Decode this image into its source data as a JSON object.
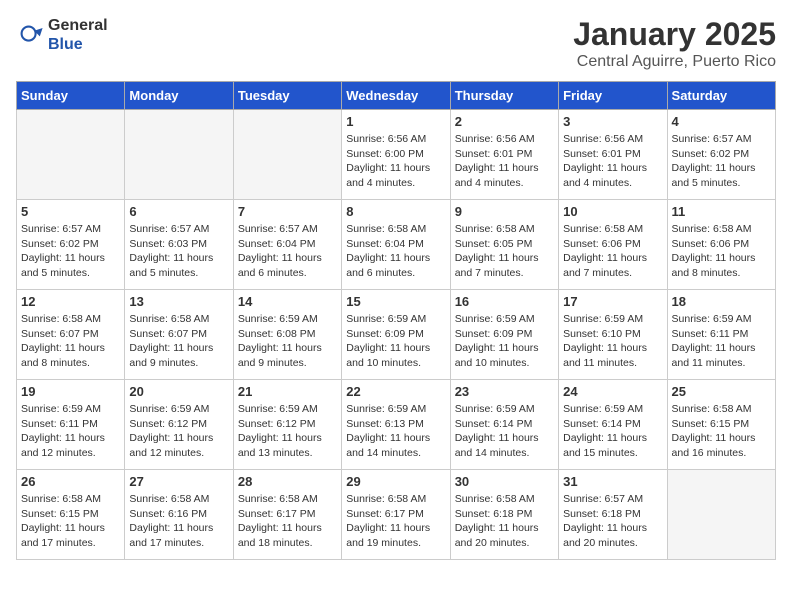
{
  "logo": {
    "general": "General",
    "blue": "Blue"
  },
  "header": {
    "month": "January 2025",
    "location": "Central Aguirre, Puerto Rico"
  },
  "days_of_week": [
    "Sunday",
    "Monday",
    "Tuesday",
    "Wednesday",
    "Thursday",
    "Friday",
    "Saturday"
  ],
  "weeks": [
    [
      {
        "day": "",
        "info": ""
      },
      {
        "day": "",
        "info": ""
      },
      {
        "day": "",
        "info": ""
      },
      {
        "day": "1",
        "info": "Sunrise: 6:56 AM\nSunset: 6:00 PM\nDaylight: 11 hours and 4 minutes."
      },
      {
        "day": "2",
        "info": "Sunrise: 6:56 AM\nSunset: 6:01 PM\nDaylight: 11 hours and 4 minutes."
      },
      {
        "day": "3",
        "info": "Sunrise: 6:56 AM\nSunset: 6:01 PM\nDaylight: 11 hours and 4 minutes."
      },
      {
        "day": "4",
        "info": "Sunrise: 6:57 AM\nSunset: 6:02 PM\nDaylight: 11 hours and 5 minutes."
      }
    ],
    [
      {
        "day": "5",
        "info": "Sunrise: 6:57 AM\nSunset: 6:02 PM\nDaylight: 11 hours and 5 minutes."
      },
      {
        "day": "6",
        "info": "Sunrise: 6:57 AM\nSunset: 6:03 PM\nDaylight: 11 hours and 5 minutes."
      },
      {
        "day": "7",
        "info": "Sunrise: 6:57 AM\nSunset: 6:04 PM\nDaylight: 11 hours and 6 minutes."
      },
      {
        "day": "8",
        "info": "Sunrise: 6:58 AM\nSunset: 6:04 PM\nDaylight: 11 hours and 6 minutes."
      },
      {
        "day": "9",
        "info": "Sunrise: 6:58 AM\nSunset: 6:05 PM\nDaylight: 11 hours and 7 minutes."
      },
      {
        "day": "10",
        "info": "Sunrise: 6:58 AM\nSunset: 6:06 PM\nDaylight: 11 hours and 7 minutes."
      },
      {
        "day": "11",
        "info": "Sunrise: 6:58 AM\nSunset: 6:06 PM\nDaylight: 11 hours and 8 minutes."
      }
    ],
    [
      {
        "day": "12",
        "info": "Sunrise: 6:58 AM\nSunset: 6:07 PM\nDaylight: 11 hours and 8 minutes."
      },
      {
        "day": "13",
        "info": "Sunrise: 6:58 AM\nSunset: 6:07 PM\nDaylight: 11 hours and 9 minutes."
      },
      {
        "day": "14",
        "info": "Sunrise: 6:59 AM\nSunset: 6:08 PM\nDaylight: 11 hours and 9 minutes."
      },
      {
        "day": "15",
        "info": "Sunrise: 6:59 AM\nSunset: 6:09 PM\nDaylight: 11 hours and 10 minutes."
      },
      {
        "day": "16",
        "info": "Sunrise: 6:59 AM\nSunset: 6:09 PM\nDaylight: 11 hours and 10 minutes."
      },
      {
        "day": "17",
        "info": "Sunrise: 6:59 AM\nSunset: 6:10 PM\nDaylight: 11 hours and 11 minutes."
      },
      {
        "day": "18",
        "info": "Sunrise: 6:59 AM\nSunset: 6:11 PM\nDaylight: 11 hours and 11 minutes."
      }
    ],
    [
      {
        "day": "19",
        "info": "Sunrise: 6:59 AM\nSunset: 6:11 PM\nDaylight: 11 hours and 12 minutes."
      },
      {
        "day": "20",
        "info": "Sunrise: 6:59 AM\nSunset: 6:12 PM\nDaylight: 11 hours and 12 minutes."
      },
      {
        "day": "21",
        "info": "Sunrise: 6:59 AM\nSunset: 6:12 PM\nDaylight: 11 hours and 13 minutes."
      },
      {
        "day": "22",
        "info": "Sunrise: 6:59 AM\nSunset: 6:13 PM\nDaylight: 11 hours and 14 minutes."
      },
      {
        "day": "23",
        "info": "Sunrise: 6:59 AM\nSunset: 6:14 PM\nDaylight: 11 hours and 14 minutes."
      },
      {
        "day": "24",
        "info": "Sunrise: 6:59 AM\nSunset: 6:14 PM\nDaylight: 11 hours and 15 minutes."
      },
      {
        "day": "25",
        "info": "Sunrise: 6:58 AM\nSunset: 6:15 PM\nDaylight: 11 hours and 16 minutes."
      }
    ],
    [
      {
        "day": "26",
        "info": "Sunrise: 6:58 AM\nSunset: 6:15 PM\nDaylight: 11 hours and 17 minutes."
      },
      {
        "day": "27",
        "info": "Sunrise: 6:58 AM\nSunset: 6:16 PM\nDaylight: 11 hours and 17 minutes."
      },
      {
        "day": "28",
        "info": "Sunrise: 6:58 AM\nSunset: 6:17 PM\nDaylight: 11 hours and 18 minutes."
      },
      {
        "day": "29",
        "info": "Sunrise: 6:58 AM\nSunset: 6:17 PM\nDaylight: 11 hours and 19 minutes."
      },
      {
        "day": "30",
        "info": "Sunrise: 6:58 AM\nSunset: 6:18 PM\nDaylight: 11 hours and 20 minutes."
      },
      {
        "day": "31",
        "info": "Sunrise: 6:57 AM\nSunset: 6:18 PM\nDaylight: 11 hours and 20 minutes."
      },
      {
        "day": "",
        "info": ""
      }
    ]
  ]
}
